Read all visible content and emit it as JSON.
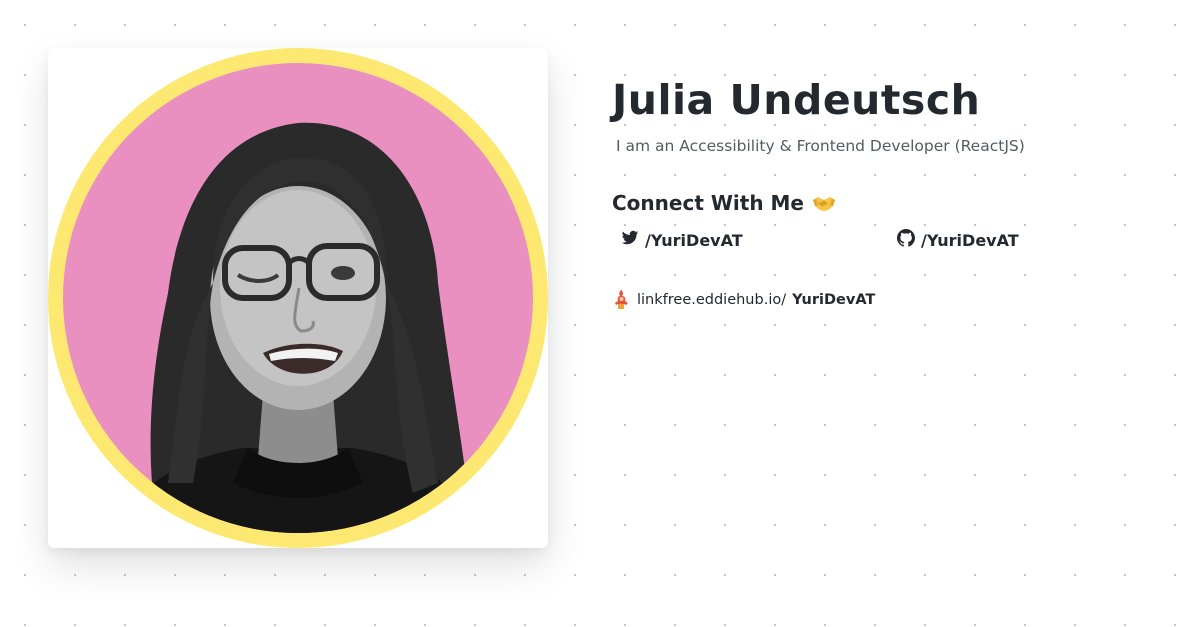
{
  "profile": {
    "name": "Julia Undeutsch",
    "bio": "I am an Accessibility & Frontend Developer (ReactJS)"
  },
  "connect": {
    "heading": "Connect With Me",
    "emoji": "🤝",
    "links": [
      {
        "platform": "twitter",
        "icon": "twitter-bird-icon",
        "label": "/YuriDevAT"
      },
      {
        "platform": "github",
        "icon": "github-octocat-icon",
        "label": "/YuriDevAT"
      }
    ]
  },
  "footer": {
    "domain": "linkfree.eddiehub.io/",
    "username": "YuriDevAT",
    "icon": "linkfree-logo-icon"
  },
  "colors": {
    "ring": "#fde972",
    "avatar_bg": "#ea90c0",
    "text": "#24292f",
    "muted": "#555b62"
  }
}
